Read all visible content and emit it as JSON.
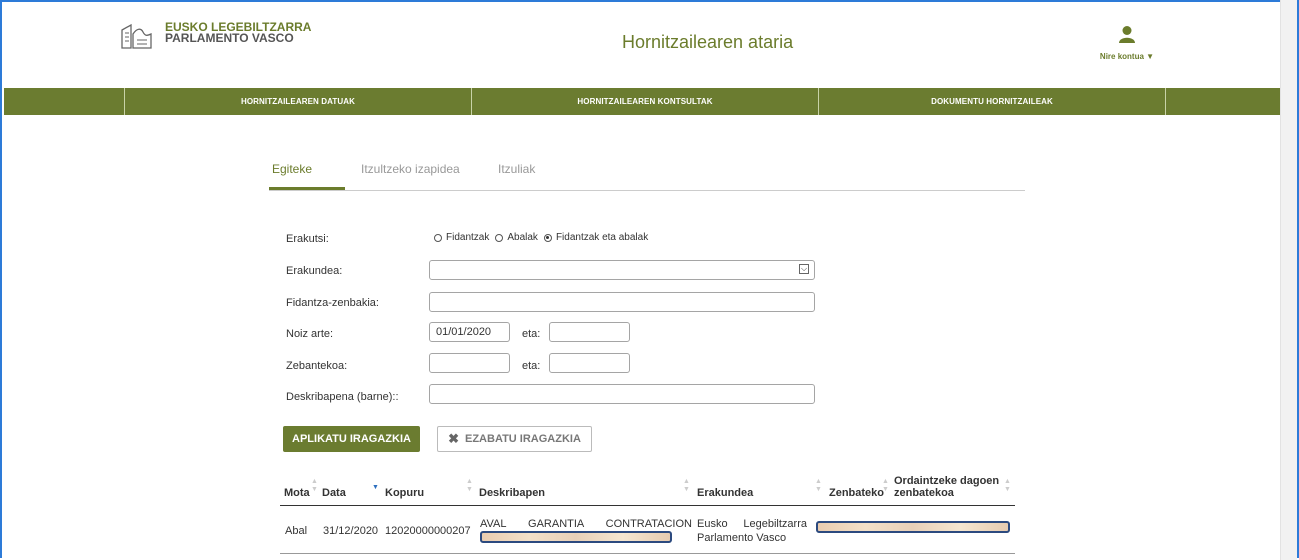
{
  "header": {
    "logo_line1": "EUSKO LEGEBILTZARRA",
    "logo_line2": "PARLAMENTO VASCO",
    "app_title": "Hornitzailearen ataria",
    "account_label": "Nire kontua ▼",
    "account_icon": "user-icon"
  },
  "nav": {
    "items": [
      "HORNITZAILEAREN DATUAK",
      "HORNITZAILEAREN KONTSULTAK",
      "DOKUMENTU HORNITZAILEAK"
    ]
  },
  "tabs": [
    "Egiteke",
    "Itzultzeko izapidea",
    "Itzuliak"
  ],
  "filters": {
    "show_label": "Erakutsi:",
    "radio_options": [
      "Fidantzak",
      "Abalak",
      "Fidantzak eta abalak"
    ],
    "radio_selected": "Fidantzak eta abalak",
    "entity_label": "Erakundea:",
    "entity_value": "",
    "guarantee_label": "Fidantza-zenbakia:",
    "guarantee_value": "",
    "until_label": "Noiz arte:",
    "until_from": "01/01/2020",
    "and_label": "eta:",
    "until_to": "",
    "amount_label": "Zebantekoa:",
    "amount_from": "",
    "amount_to": "",
    "description_label": "Deskribapena (barne)::",
    "description_value": ""
  },
  "buttons": {
    "apply": "APLIKATU IRAGAZKIA",
    "clear": "EZABATU IRAGAZKIA"
  },
  "table": {
    "columns": [
      "Mota",
      "Data",
      "Kopuru",
      "Deskribapen",
      "Erakundea",
      "Zenbateko",
      "Ordaintzeke dagoen",
      "zenbatekoa"
    ],
    "rows": [
      {
        "type": "Abal",
        "date": "31/12/2020",
        "amount": "12020000000207",
        "description": "AVAL GARANTIA CONTRATACION",
        "entity_line1": "Eusko Legebiltzarra",
        "entity_line2": "Parlamento Vasco"
      }
    ]
  }
}
